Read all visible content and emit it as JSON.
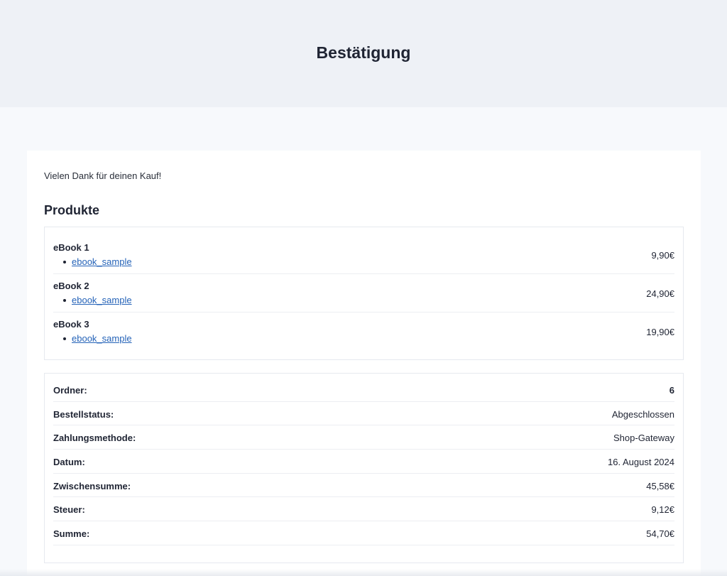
{
  "header": {
    "title": "Bestätigung"
  },
  "content": {
    "thanks": "Vielen Dank für deinen Kauf!",
    "products_title": "Produkte",
    "products": [
      {
        "name": "eBook 1",
        "file": "ebook_sample",
        "price": "9,90€"
      },
      {
        "name": "eBook 2",
        "file": "ebook_sample",
        "price": "24,90€"
      },
      {
        "name": "eBook 3",
        "file": "ebook_sample",
        "price": "19,90€"
      }
    ],
    "summary": [
      {
        "label": "Ordner:",
        "value": "6"
      },
      {
        "label": "Bestellstatus:",
        "value": "Abgeschlossen"
      },
      {
        "label": "Zahlungsmethode:",
        "value": "Shop-Gateway"
      },
      {
        "label": "Datum:",
        "value": "16. August 2024"
      },
      {
        "label": "Zwischensumme:",
        "value": "45,58€"
      },
      {
        "label": "Steuer:",
        "value": "9,12€"
      },
      {
        "label": "Summe:",
        "value": "54,70€"
      }
    ]
  },
  "colors": {
    "header_bg": "#eef1f6",
    "page_bg": "#f7f9fc",
    "link": "#2563b8",
    "text": "#1f2433"
  }
}
